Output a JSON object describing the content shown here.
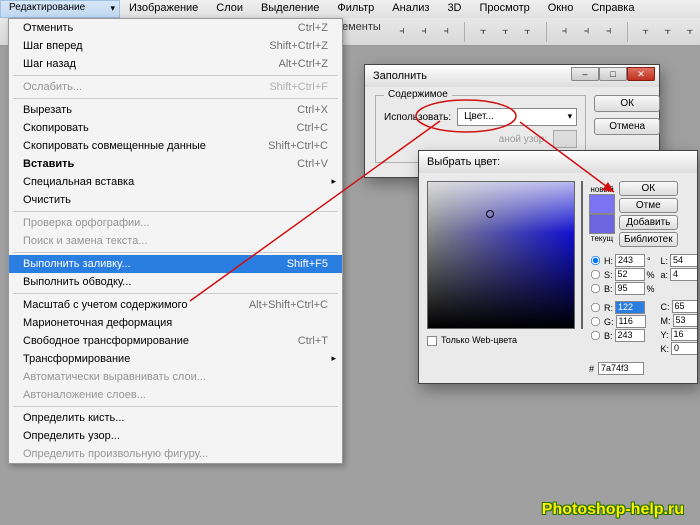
{
  "menubar": {
    "items": [
      "Редактирование",
      "Изображение",
      "Слои",
      "Выделение",
      "Фильтр",
      "Анализ",
      "3D",
      "Просмотр",
      "Окно",
      "Справка"
    ]
  },
  "toolbar": {
    "hint": "ементы"
  },
  "dropdown": {
    "groups": [
      [
        {
          "label": "Отменить",
          "shortcut": "Ctrl+Z",
          "disabled": false
        },
        {
          "label": "Шаг вперед",
          "shortcut": "Shift+Ctrl+Z",
          "disabled": false
        },
        {
          "label": "Шаг назад",
          "shortcut": "Alt+Ctrl+Z",
          "disabled": false
        }
      ],
      [
        {
          "label": "Ослабить...",
          "shortcut": "Shift+Ctrl+F",
          "disabled": true
        }
      ],
      [
        {
          "label": "Вырезать",
          "shortcut": "Ctrl+X",
          "disabled": false
        },
        {
          "label": "Скопировать",
          "shortcut": "Ctrl+C",
          "disabled": false
        },
        {
          "label": "Скопировать совмещенные данные",
          "shortcut": "Shift+Ctrl+C",
          "disabled": false
        },
        {
          "label": "Вставить",
          "shortcut": "Ctrl+V",
          "disabled": false,
          "bold": true
        },
        {
          "label": "Специальная вставка",
          "shortcut": "",
          "disabled": false,
          "sub": true
        },
        {
          "label": "Очистить",
          "shortcut": "",
          "disabled": false
        }
      ],
      [
        {
          "label": "Проверка орфографии...",
          "shortcut": "",
          "disabled": true
        },
        {
          "label": "Поиск и замена текста...",
          "shortcut": "",
          "disabled": true
        }
      ],
      [
        {
          "label": "Выполнить заливку...",
          "shortcut": "Shift+F5",
          "disabled": false,
          "highlight": true
        },
        {
          "label": "Выполнить обводку...",
          "shortcut": "",
          "disabled": false
        }
      ],
      [
        {
          "label": "Масштаб с учетом содержимого",
          "shortcut": "Alt+Shift+Ctrl+C",
          "disabled": false
        },
        {
          "label": "Марионеточная деформация",
          "shortcut": "",
          "disabled": false
        },
        {
          "label": "Свободное трансформирование",
          "shortcut": "Ctrl+T",
          "disabled": false
        },
        {
          "label": "Трансформирование",
          "shortcut": "",
          "disabled": false,
          "sub": true
        },
        {
          "label": "Автоматически выравнивать слои...",
          "shortcut": "",
          "disabled": true
        },
        {
          "label": "Автоналожение слоев...",
          "shortcut": "",
          "disabled": true
        }
      ],
      [
        {
          "label": "Определить кисть...",
          "shortcut": "",
          "disabled": false
        },
        {
          "label": "Определить узор...",
          "shortcut": "",
          "disabled": false
        },
        {
          "label": "Определить произвольную фигуру...",
          "shortcut": "",
          "disabled": true
        }
      ]
    ]
  },
  "fill_dialog": {
    "title": "Заполнить",
    "content_group": "Содержимое",
    "use_label": "Использовать:",
    "use_value": "Цвет...",
    "pattern_label": "аной узор:",
    "ok": "ОК",
    "cancel": "Отмена"
  },
  "color_dialog": {
    "title": "Выбрать цвет:",
    "new_label": "новый",
    "current_label": "текущ",
    "ok": "ОК",
    "cancel": "Отме",
    "add": "Добавить",
    "libs": "Библиотек",
    "webonly": "Только Web-цвета",
    "hsb": {
      "h_label": "H:",
      "h": "243",
      "h_unit": "°",
      "s_label": "S:",
      "s": "52",
      "s_unit": "%",
      "b_label": "B:",
      "b": "95",
      "b_unit": "%"
    },
    "rgb": {
      "r_label": "R:",
      "r": "122",
      "g_label": "G:",
      "g": "116",
      "b_label": "B:",
      "b": "243"
    },
    "lab": {
      "l_label": "L:",
      "l": "54",
      "a_label": "a:",
      "a": "4"
    },
    "cmyk": {
      "c_label": "C:",
      "c": "65",
      "m_label": "M:",
      "m": "53",
      "y_label": "Y:",
      "y": "16",
      "k_label": "K:",
      "k": "0"
    },
    "hex_label": "#",
    "hex": "7a74f3"
  },
  "watermark": "Photoshop-help.ru"
}
